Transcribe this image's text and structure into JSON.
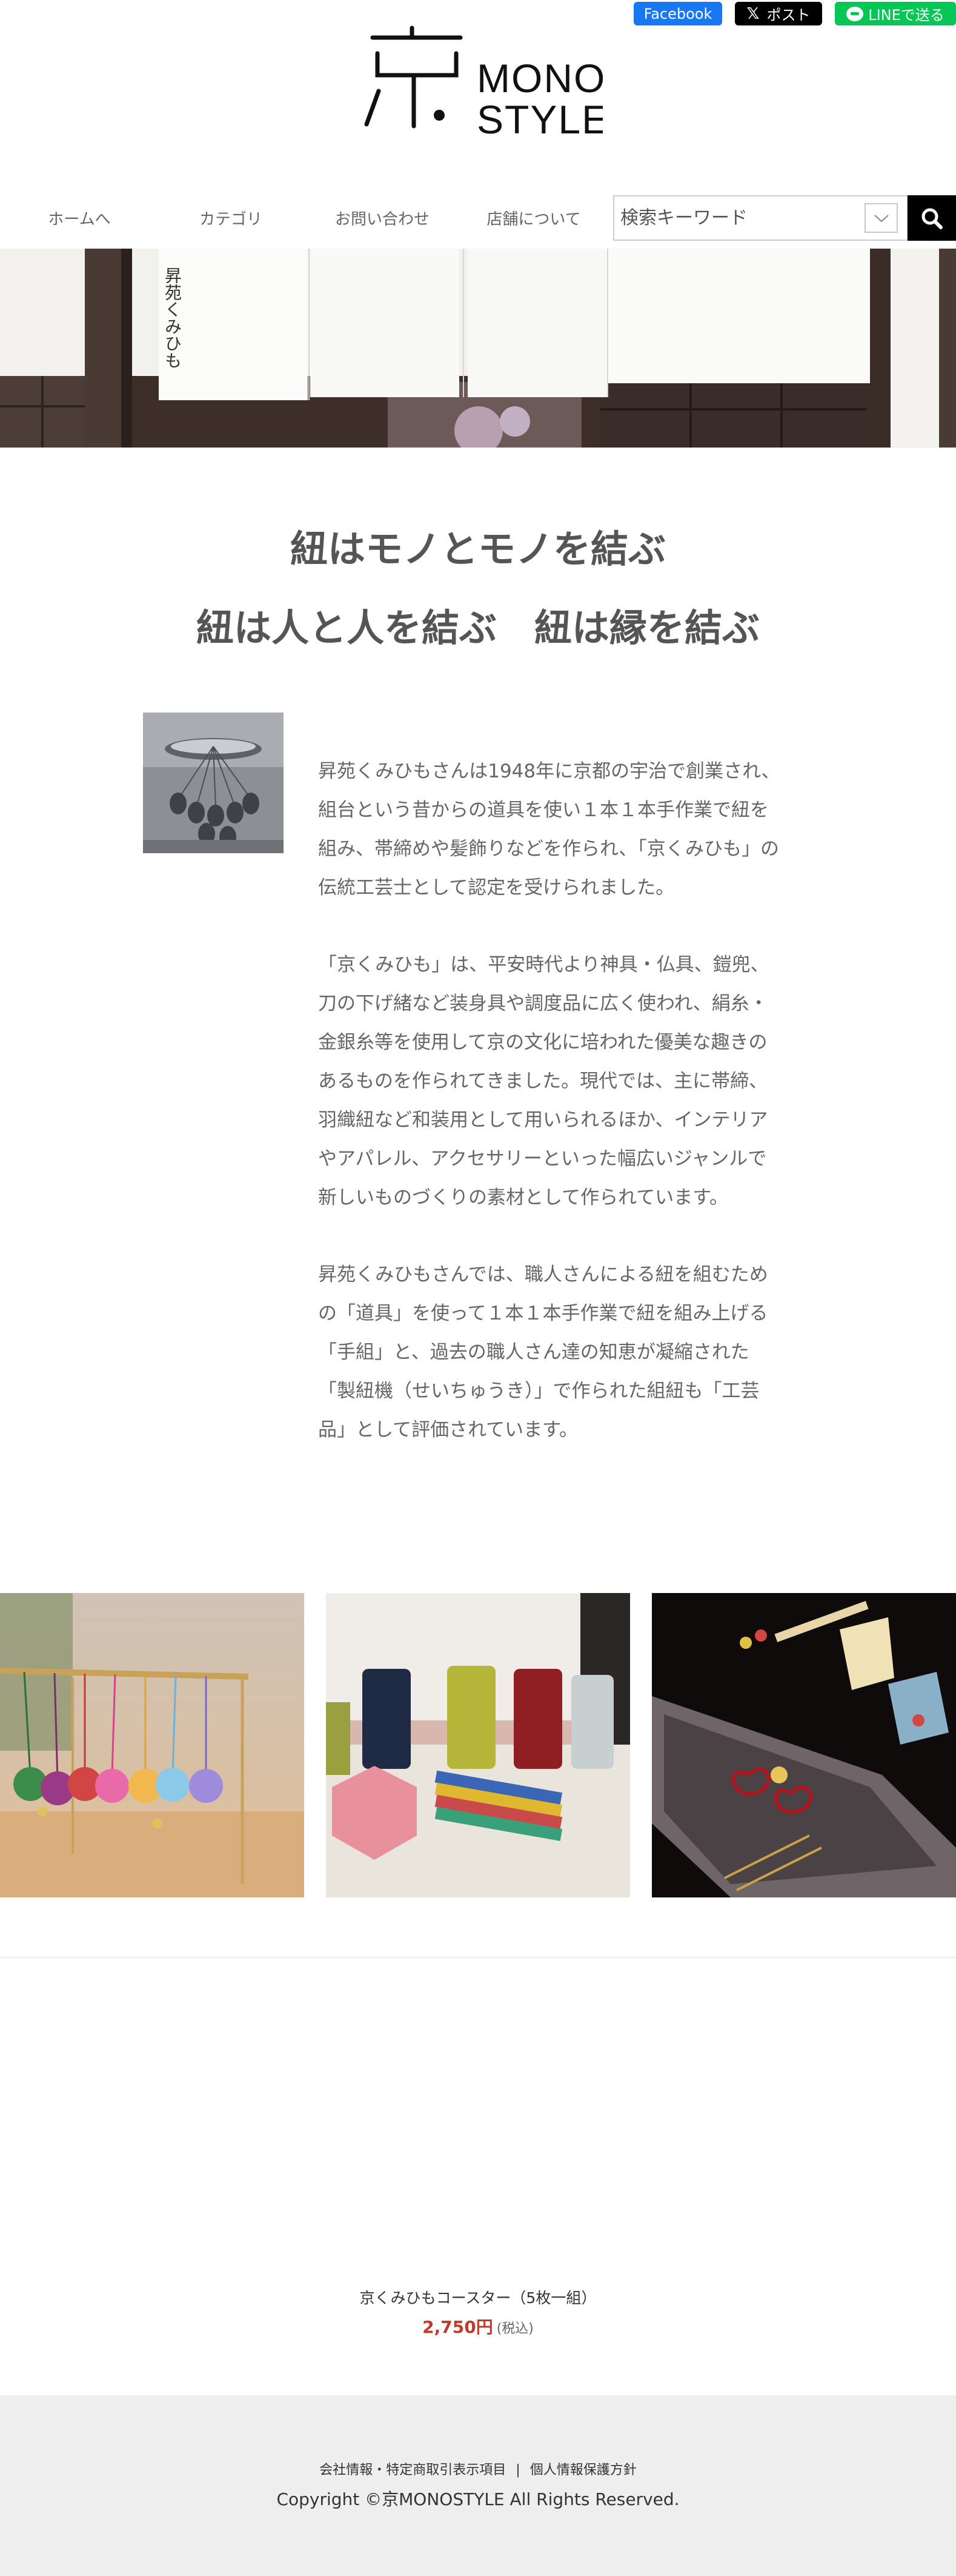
{
  "share": {
    "facebook": "Facebook",
    "x": "ポスト",
    "line": "LINEで送る"
  },
  "logo": {
    "kanji": "京",
    "line1": "MONO",
    "line2": "STYLE"
  },
  "nav": {
    "items": [
      "ホームへ",
      "カテゴリ",
      "お問い合わせ",
      "店舗について"
    ]
  },
  "search": {
    "placeholder": "検索キーワード"
  },
  "hero": {
    "noren_text": "昇苑くみひも"
  },
  "intro": {
    "title_line1": "紐はモノとモノを結ぶ",
    "title_line2": "紐は人と人を結ぶ　紐は縁を結ぶ",
    "paragraphs": [
      "昇苑くみひもさんは1948年に京都の宇治で創業され、組台という昔からの道具を使い１本１本手作業で紐を組み、帯締めや髪飾りなどを作られ、「京くみひも」の伝統工芸士として認定を受けられました。",
      "「京くみひも」は、平安時代より神具・仏具、鎧兜、刀の下げ緒など装身具や調度品に広く使われ、絹糸・金銀糸等を使用して京の文化に培われた優美な趣きのあるものを作られてきました。現代では、主に帯締、羽織紐など和装用として用いられるほか、インテリアやアパレル、アクセサリーといった幅広いジャンルで新しいものづくりの素材として作られています。",
      "昇苑くみひもさんでは、職人さんによる紐を組むための「道具」を使って１本１本手作業で紐を組み上げる「手組」と、過去の職人さん達の知恵が凝縮された「製紐機（せいちゅうき）」で作られた組紐も「工芸品」として評価されています。"
    ]
  },
  "product": {
    "name": "京くみひもコースター（5枚一組）",
    "price": "2,750円",
    "tax": "(税込)"
  },
  "footer": {
    "link1": "会社情報・特定商取引表示項目",
    "separator": "|",
    "link2": "個人情報保護方針",
    "copyright": "Copyright ©京MONOSTYLE All Rights Reserved."
  },
  "colors": {
    "facebook": "#1877f2",
    "x": "#000000",
    "line": "#06c755",
    "price": "#c0392b",
    "footer_bg": "#eeeeee"
  }
}
